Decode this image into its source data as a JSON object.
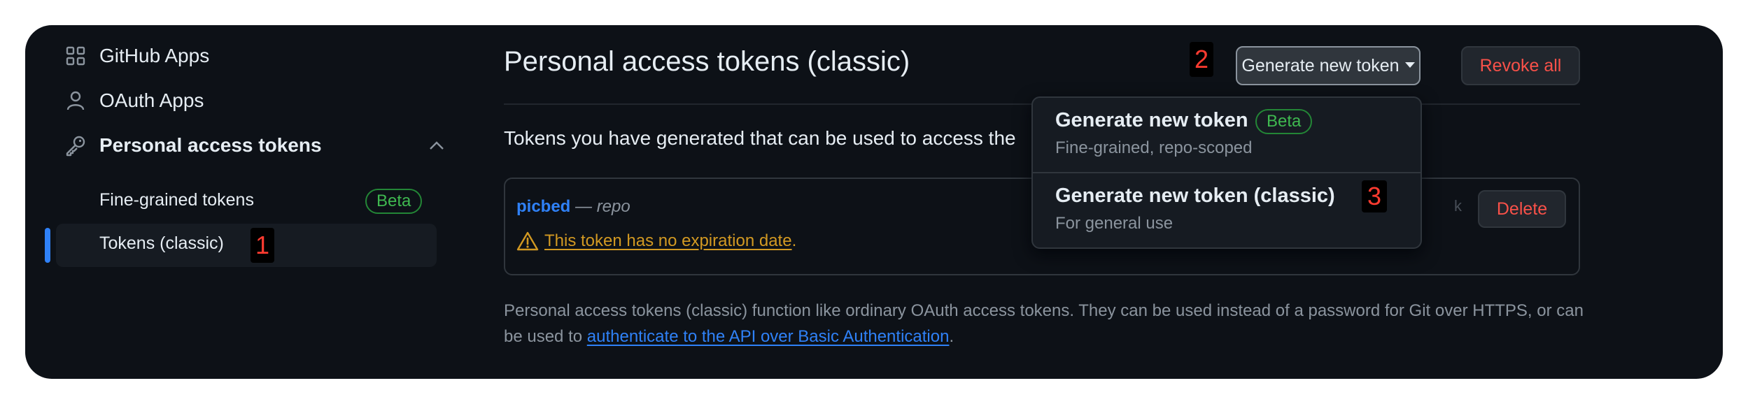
{
  "sidebar": {
    "items": [
      {
        "label": "GitHub Apps",
        "icon": "apps-grid-icon"
      },
      {
        "label": "OAuth Apps",
        "icon": "person-icon"
      },
      {
        "label": "Personal access tokens",
        "icon": "key-icon"
      }
    ],
    "subitems": [
      {
        "label": "Fine-grained tokens",
        "badge": "Beta"
      },
      {
        "label": "Tokens (classic)"
      }
    ]
  },
  "annotations": {
    "step1": "1",
    "step2": "2",
    "step3": "3"
  },
  "main": {
    "title": "Personal access tokens (classic)",
    "generate_button": "Generate new token",
    "revoke_button": "Revoke all",
    "description": "Tokens you have generated that can be used to access the",
    "token": {
      "name": "picbed",
      "separator": " — ",
      "scope": "repo",
      "warning": "This token has no expiration date",
      "warning_end": ".",
      "delete_button": "Delete"
    },
    "footer": {
      "text_before": "Personal access tokens (classic) function like ordinary OAuth access tokens. They can be used instead of a password for Git over HTTPS, or can be used to ",
      "link": "authenticate to the API over Basic Authentication",
      "text_after": "."
    }
  },
  "dropdown": {
    "items": [
      {
        "title": "Generate new token",
        "badge": "Beta",
        "subtitle": "Fine-grained, repo-scoped"
      },
      {
        "title": "Generate new token (classic)",
        "subtitle": "For general use"
      }
    ]
  },
  "colors": {
    "background": "#0d1117",
    "accent_blue": "#2f81f7",
    "danger": "#f85149",
    "success": "#3fb950",
    "warning": "#d29922"
  }
}
